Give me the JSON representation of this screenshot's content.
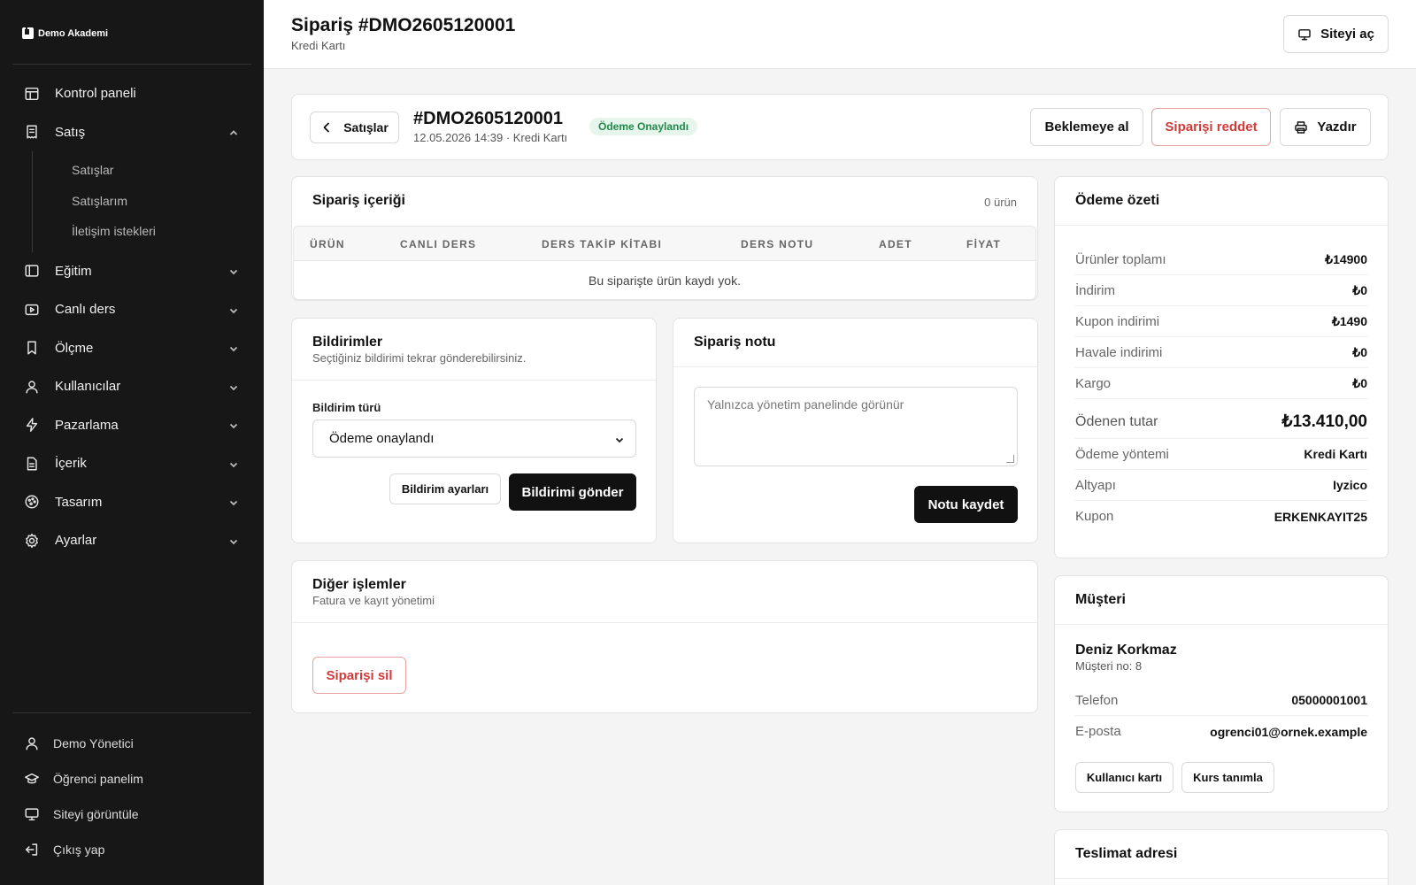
{
  "sidebar": {
    "brand": "Demo Akademi",
    "items": [
      {
        "label": "Kontrol paneli"
      },
      {
        "label": "Satış"
      },
      {
        "label": "Eğitim"
      },
      {
        "label": "Canlı ders"
      },
      {
        "label": "Ölçme"
      },
      {
        "label": "Kullanıcılar"
      },
      {
        "label": "Pazarlama"
      },
      {
        "label": "İçerik"
      },
      {
        "label": "Tasarım"
      },
      {
        "label": "Ayarlar"
      }
    ],
    "sales_sub": [
      {
        "label": "Satışlar"
      },
      {
        "label": "Satışlarım"
      },
      {
        "label": "İletişim istekleri"
      }
    ],
    "bottom": [
      {
        "label": "Demo Yönetici"
      },
      {
        "label": "Öğrenci panelim"
      },
      {
        "label": "Siteyi görüntüle"
      },
      {
        "label": "Çıkış yap"
      }
    ]
  },
  "header": {
    "title": "Sipariş #DMO2605120001",
    "subtitle": "Kredi Kartı",
    "open_site": "Siteyi aç"
  },
  "order": {
    "back_label": "Satışlar",
    "number": "#DMO2605120001",
    "meta": "12.05.2026 14:39 · Kredi Kartı",
    "status": "Ödeme Onaylandı",
    "hold_label": "Beklemeye al",
    "reject_label": "Siparişi reddet",
    "print_label": "Yazdır"
  },
  "items": {
    "title": "Sipariş içeriği",
    "count": "0 ürün",
    "columns": [
      "ÜRÜN",
      "CANLI DERS",
      "DERS TAKİP KİTABI",
      "DERS NOTU",
      "ADET",
      "FİYAT"
    ],
    "empty": "Bu siparişte ürün kaydı yok."
  },
  "notifications": {
    "title": "Bildirimler",
    "subtitle": "Seçtiğiniz bildirimi tekrar gönderebilirsiniz.",
    "type_label": "Bildirim türü",
    "selected_type": "Ödeme onaylandı",
    "settings_label": "Bildirim ayarları",
    "send_label": "Bildirimi gönder"
  },
  "note": {
    "title": "Sipariş notu",
    "placeholder": "Yalnızca yönetim panelinde görünür",
    "save_label": "Notu kaydet"
  },
  "other": {
    "title": "Diğer işlemler",
    "subtitle": "Fatura ve kayıt yönetimi",
    "delete_label": "Siparişi sil"
  },
  "payment": {
    "title": "Ödeme özeti",
    "rows": [
      {
        "k": "Ürünler toplamı",
        "v": "₺14900"
      },
      {
        "k": "İndirim",
        "v": "₺0"
      },
      {
        "k": "Kupon indirimi",
        "v": "₺1490"
      },
      {
        "k": "Havale indirimi",
        "v": "₺0"
      },
      {
        "k": "Kargo",
        "v": "₺0"
      },
      {
        "k": "Ödenen tutar",
        "v": "₺13.410,00"
      },
      {
        "k": "Ödeme yöntemi",
        "v": "Kredi Kartı"
      },
      {
        "k": "Altyapı",
        "v": "Iyzico"
      },
      {
        "k": "Kupon",
        "v": "ERKENKAYIT25"
      }
    ]
  },
  "customer": {
    "title": "Müşteri",
    "name": "Deniz Korkmaz",
    "number": "Müşteri no: 8",
    "rows": [
      {
        "k": "Telefon",
        "v": "05000001001"
      },
      {
        "k": "E-posta",
        "v": "ogrenci01@ornek.example"
      }
    ],
    "user_card_label": "Kullanıcı kartı",
    "course_label": "Kurs tanımla"
  },
  "delivery": {
    "title": "Teslimat adresi"
  },
  "colors": {
    "sidebar_bg": "#171717",
    "status_green": "#1f8a47",
    "danger_red": "#d33a3a",
    "dark_button": "#111111"
  }
}
